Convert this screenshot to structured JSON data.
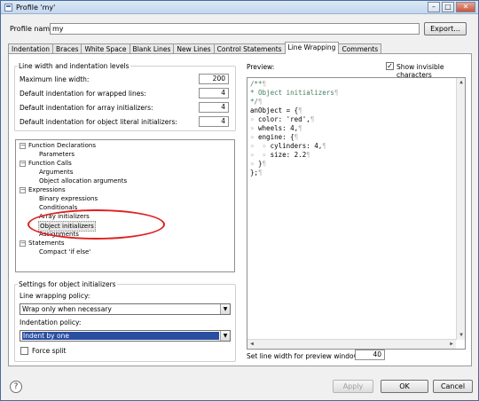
{
  "window": {
    "title": "Profile 'my'",
    "controls": {
      "min": "–",
      "max": "□",
      "close": "✕"
    }
  },
  "profile": {
    "label": "Profile name:",
    "value": "my",
    "export_label": "Export..."
  },
  "tabs": [
    "Indentation",
    "Braces",
    "White Space",
    "Blank Lines",
    "New Lines",
    "Control Statements",
    "Line Wrapping",
    "Comments"
  ],
  "active_tab": "Line Wrapping",
  "line_width": {
    "group_title": "Line width and indentation levels",
    "rows": [
      {
        "label": "Maximum line width:",
        "value": "200"
      },
      {
        "label": "Default indentation for wrapped lines:",
        "value": "4"
      },
      {
        "label": "Default indentation for array initializers:",
        "value": "4"
      },
      {
        "label": "Default indentation for object literal initializers:",
        "value": "4"
      }
    ]
  },
  "tree": {
    "items": [
      {
        "label": "Function Declarations",
        "expander": "−"
      },
      {
        "label": "Parameters"
      },
      {
        "label": "Function Calls",
        "expander": "−"
      },
      {
        "label": "Arguments"
      },
      {
        "label": "Object allocation arguments"
      },
      {
        "label": "Expressions",
        "expander": "−"
      },
      {
        "label": "Binary expressions"
      },
      {
        "label": "Conditionals"
      },
      {
        "label": "Array initializers"
      },
      {
        "label": "Object initializers"
      },
      {
        "label": "Assignments"
      },
      {
        "label": "Statements",
        "expander": "−"
      },
      {
        "label": "Compact 'if else'"
      }
    ]
  },
  "settings": {
    "group_title": "Settings for object initializers",
    "wrap_label": "Line wrapping policy:",
    "wrap_value": "Wrap only when necessary",
    "indent_label": "Indentation policy:",
    "indent_value": "Indent by one",
    "force_split": "Force split"
  },
  "preview": {
    "label": "Preview:",
    "show_invisible": "Show invisible characters",
    "checked": "✓",
    "width_label": "Set line width for preview window:",
    "width_value": "40",
    "code": [
      {
        "text": "/**",
        "ws": "¶"
      },
      {
        "text": "* Object initializers",
        "ws": "¶"
      },
      {
        "text": "*/",
        "ws": "¶"
      },
      {
        "text": "anObject = {",
        "ws": "¶"
      },
      {
        "pre": "» ",
        "text": "color: 'red',",
        "ws": "¶"
      },
      {
        "pre": "» ",
        "text": "wheels: 4,",
        "ws": "¶"
      },
      {
        "pre": "» ",
        "text": "engine: {",
        "ws": "¶"
      },
      {
        "pre": "»  » ",
        "text": "cylinders: 4,",
        "ws": "¶"
      },
      {
        "pre": "»  » ",
        "text": "size: 2.2",
        "ws": "¶"
      },
      {
        "pre": "» ",
        "text": "}",
        "ws": "¶"
      },
      {
        "text": "};",
        "ws": "¶"
      }
    ]
  },
  "footer": {
    "help": "?",
    "apply": "Apply",
    "ok": "OK",
    "cancel": "Cancel"
  },
  "colors": {
    "highlight_ellipse": "#e02020",
    "selection": "#2a4ea0"
  }
}
